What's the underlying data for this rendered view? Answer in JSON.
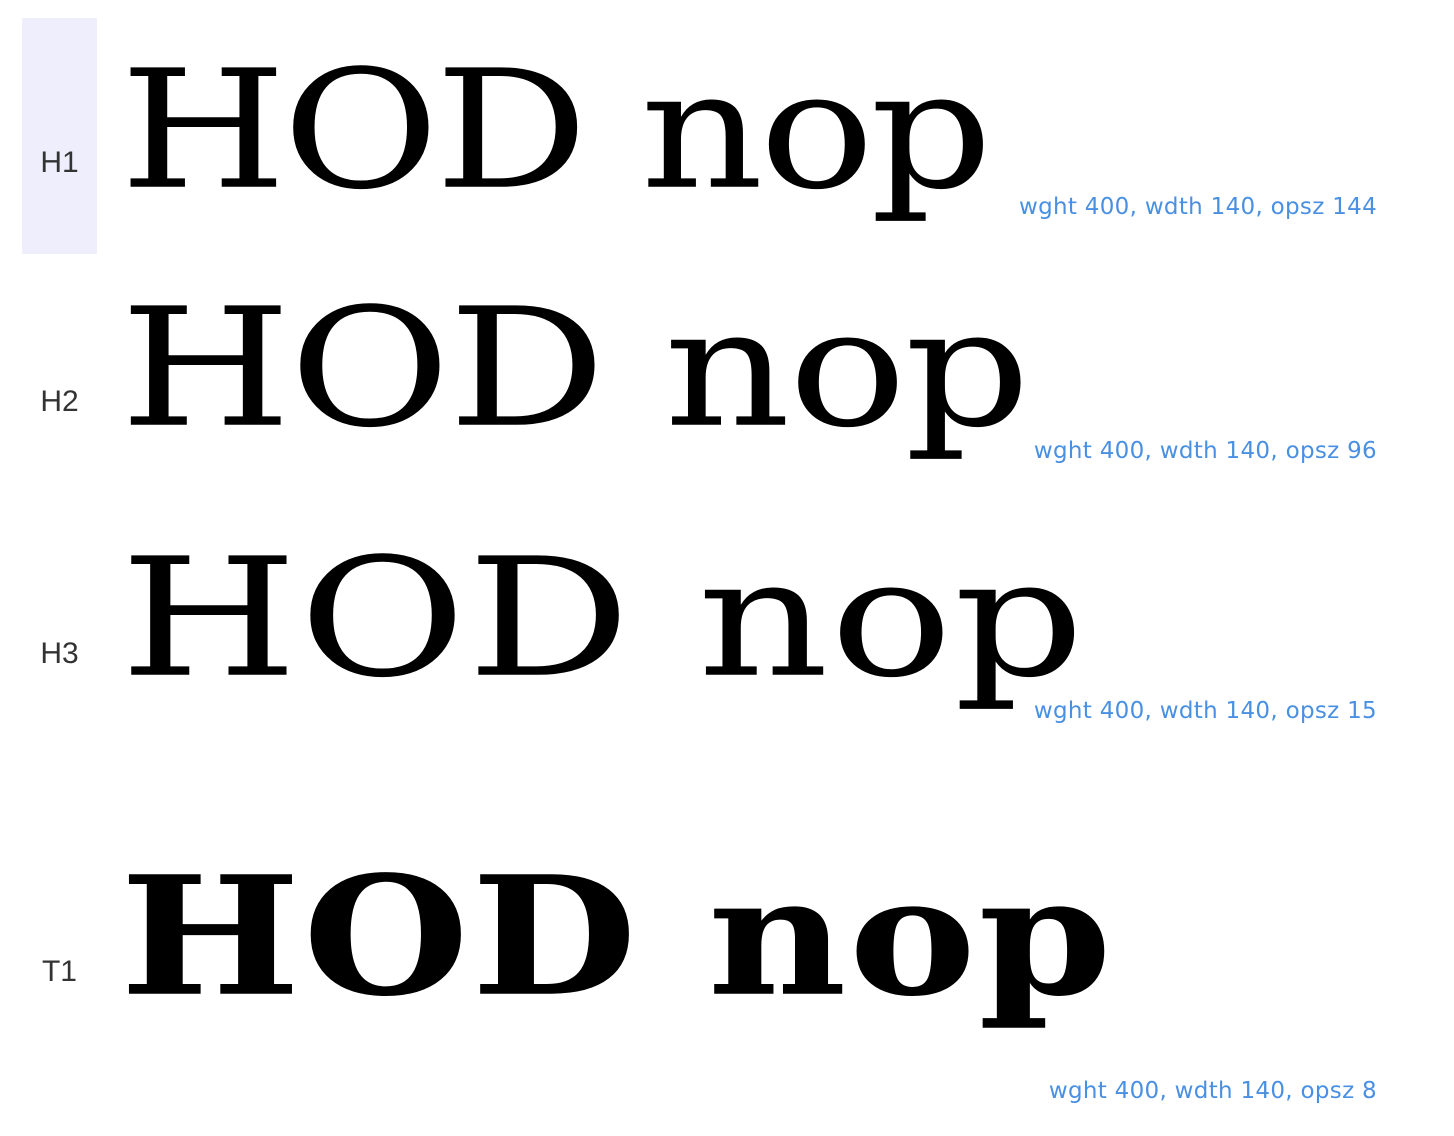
{
  "rows": [
    {
      "tag": "H1",
      "sample": "HOD nop",
      "axes": "wght 400, wdth 140, opsz 144",
      "selected": true
    },
    {
      "tag": "H2",
      "sample": "HOD nop",
      "axes": "wght 400, wdth 140, opsz 96",
      "selected": false
    },
    {
      "tag": "H3",
      "sample": "HOD nop",
      "axes": "wght 400, wdth 140, opsz 15",
      "selected": false
    },
    {
      "tag": "T1",
      "sample": "HOD nop",
      "axes": "wght 400, wdth 140, opsz 8",
      "selected": false
    }
  ]
}
